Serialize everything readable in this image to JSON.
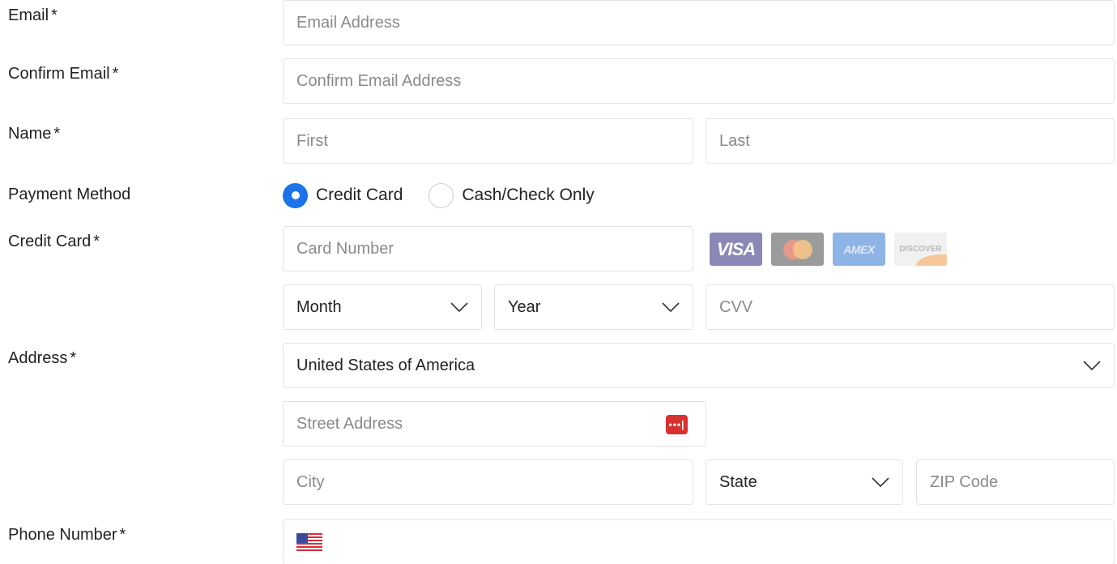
{
  "labels": {
    "email": "Email",
    "confirm_email": "Confirm Email",
    "name": "Name",
    "payment_method": "Payment Method",
    "credit_card": "Credit Card",
    "address": "Address",
    "phone": "Phone Number",
    "required_mark": "*"
  },
  "fields": {
    "email_placeholder": "Email Address",
    "confirm_email_placeholder": "Confirm Email Address",
    "first_placeholder": "First",
    "last_placeholder": "Last",
    "card_number_placeholder": "Card Number",
    "cvv_placeholder": "CVV",
    "street_placeholder": "Street Address",
    "city_placeholder": "City",
    "zip_placeholder": "ZIP Code"
  },
  "selects": {
    "month": "Month",
    "year": "Year",
    "country": "United States of America",
    "state": "State"
  },
  "payment": {
    "option_credit": "Credit Card",
    "option_cash": "Cash/Check Only",
    "selected": "Credit Card"
  },
  "card_brands": {
    "visa": "VISA",
    "amex": "AMEX",
    "discover": "DISCOVER"
  },
  "password_icon_text": "•••|",
  "colors": {
    "accent": "#1a73e8",
    "border": "#e3e3e3",
    "placeholder": "#8a8a8a",
    "password_icon": "#d9312f"
  }
}
